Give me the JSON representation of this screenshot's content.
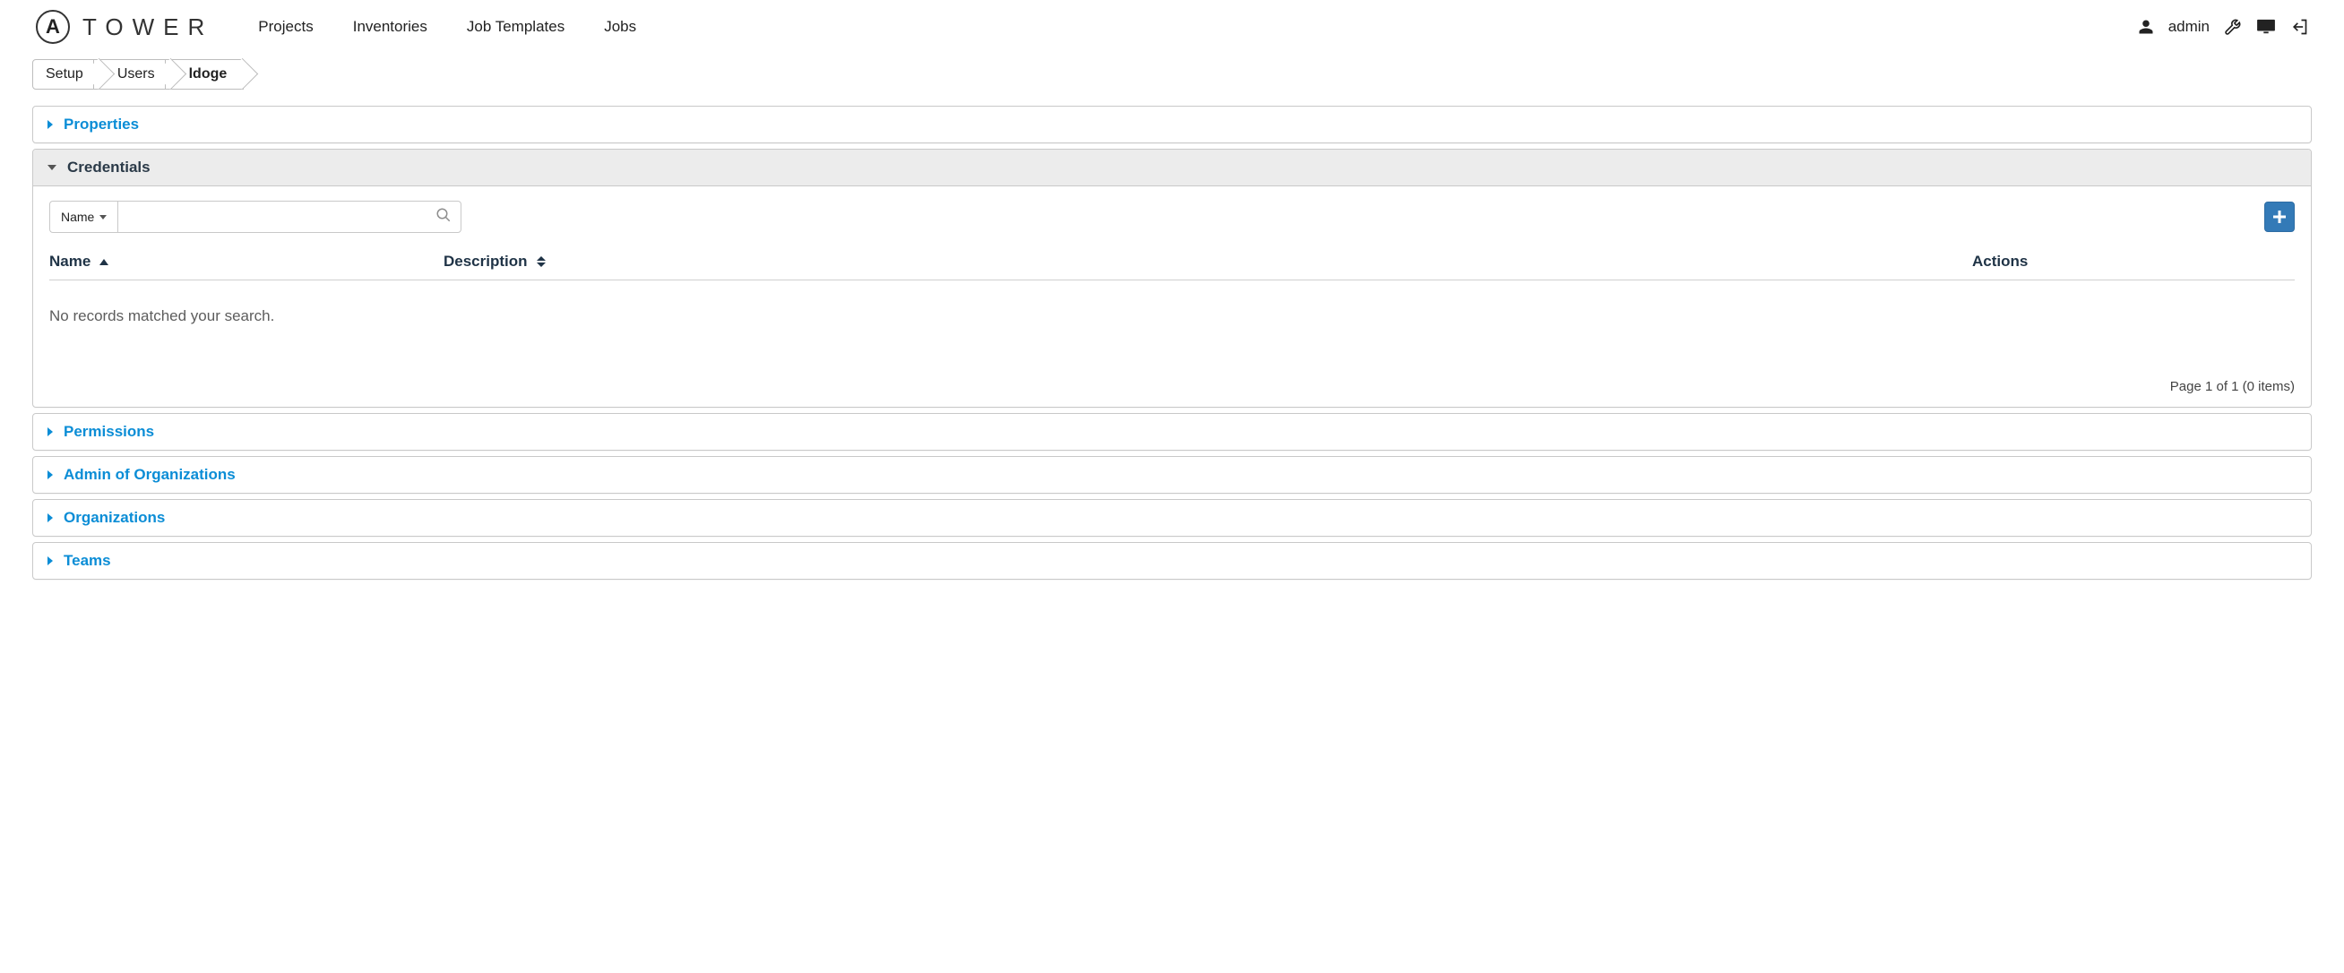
{
  "brand": {
    "mark": "A",
    "name": "TOWER"
  },
  "nav": {
    "projects": "Projects",
    "inventories": "Inventories",
    "job_templates": "Job Templates",
    "jobs": "Jobs"
  },
  "user": {
    "name": "admin"
  },
  "breadcrumbs": {
    "setup": "Setup",
    "users": "Users",
    "current": "ldoge"
  },
  "panels": {
    "properties": "Properties",
    "credentials": "Credentials",
    "permissions": "Permissions",
    "admin_orgs": "Admin of Organizations",
    "organizations": "Organizations",
    "teams": "Teams"
  },
  "credentials": {
    "filter_field": "Name",
    "search_value": "",
    "columns": {
      "name": "Name",
      "description": "Description",
      "actions": "Actions"
    },
    "empty": "No records matched your search.",
    "pager": "Page 1 of 1 (0 items)"
  }
}
